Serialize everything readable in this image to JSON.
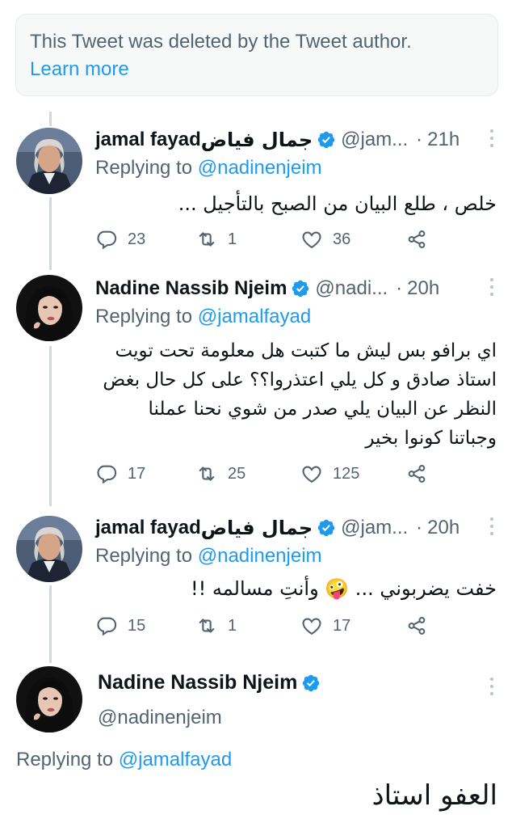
{
  "deleted_notice": {
    "text": "This Tweet was deleted by the Tweet author.",
    "link": "Learn more"
  },
  "tweets": [
    {
      "name": "jamal fayad",
      "name_ar": "جمال فياض",
      "handle": "@jam...",
      "dot": "·",
      "time": "21h",
      "replying_prefix": "Replying to",
      "replying_to": "@nadinenjeim",
      "text": "خلص ، طلع البيان من الصبح بالتأجيل ...",
      "replies": "23",
      "retweets": "1",
      "likes": "36"
    },
    {
      "name": "Nadine Nassib Njeim",
      "handle": "@nadi...",
      "dot": "·",
      "time": "20h",
      "replying_prefix": "Replying to",
      "replying_to": "@jamalfayad",
      "text": "اي برافو بس ليش ما كتبت هل معلومة تحت تويت استاذ صادق و كل يلي اعتذروا؟؟ على كل حال بغض النظر عن البيان يلي صدر من شوي نحنا عملنا وجباتنا كونوا بخير",
      "replies": "17",
      "retweets": "25",
      "likes": "125"
    },
    {
      "name": "jamal fayad",
      "name_ar": "جمال فياض",
      "handle": "@jam...",
      "dot": "·",
      "time": "20h",
      "replying_prefix": "Replying to",
      "replying_to": "@nadinenjeim",
      "text": "خفت يضربوني ... 🤪 وأنتِ مسالمه !!",
      "replies": "15",
      "retweets": "1",
      "likes": "17"
    }
  ],
  "main_tweet": {
    "name": "Nadine Nassib Njeim",
    "handle": "@nadinenjeim",
    "replying_prefix": "Replying to",
    "replying_to": "@jamalfayad",
    "text": "العفو استاذ"
  },
  "colors": {
    "accent": "#1d9bf0",
    "secondary_text": "#536471",
    "thread_line": "#cfd9de"
  },
  "icons": [
    "verified-badge-icon",
    "more-icon",
    "reply-icon",
    "retweet-icon",
    "like-icon",
    "share-icon"
  ]
}
